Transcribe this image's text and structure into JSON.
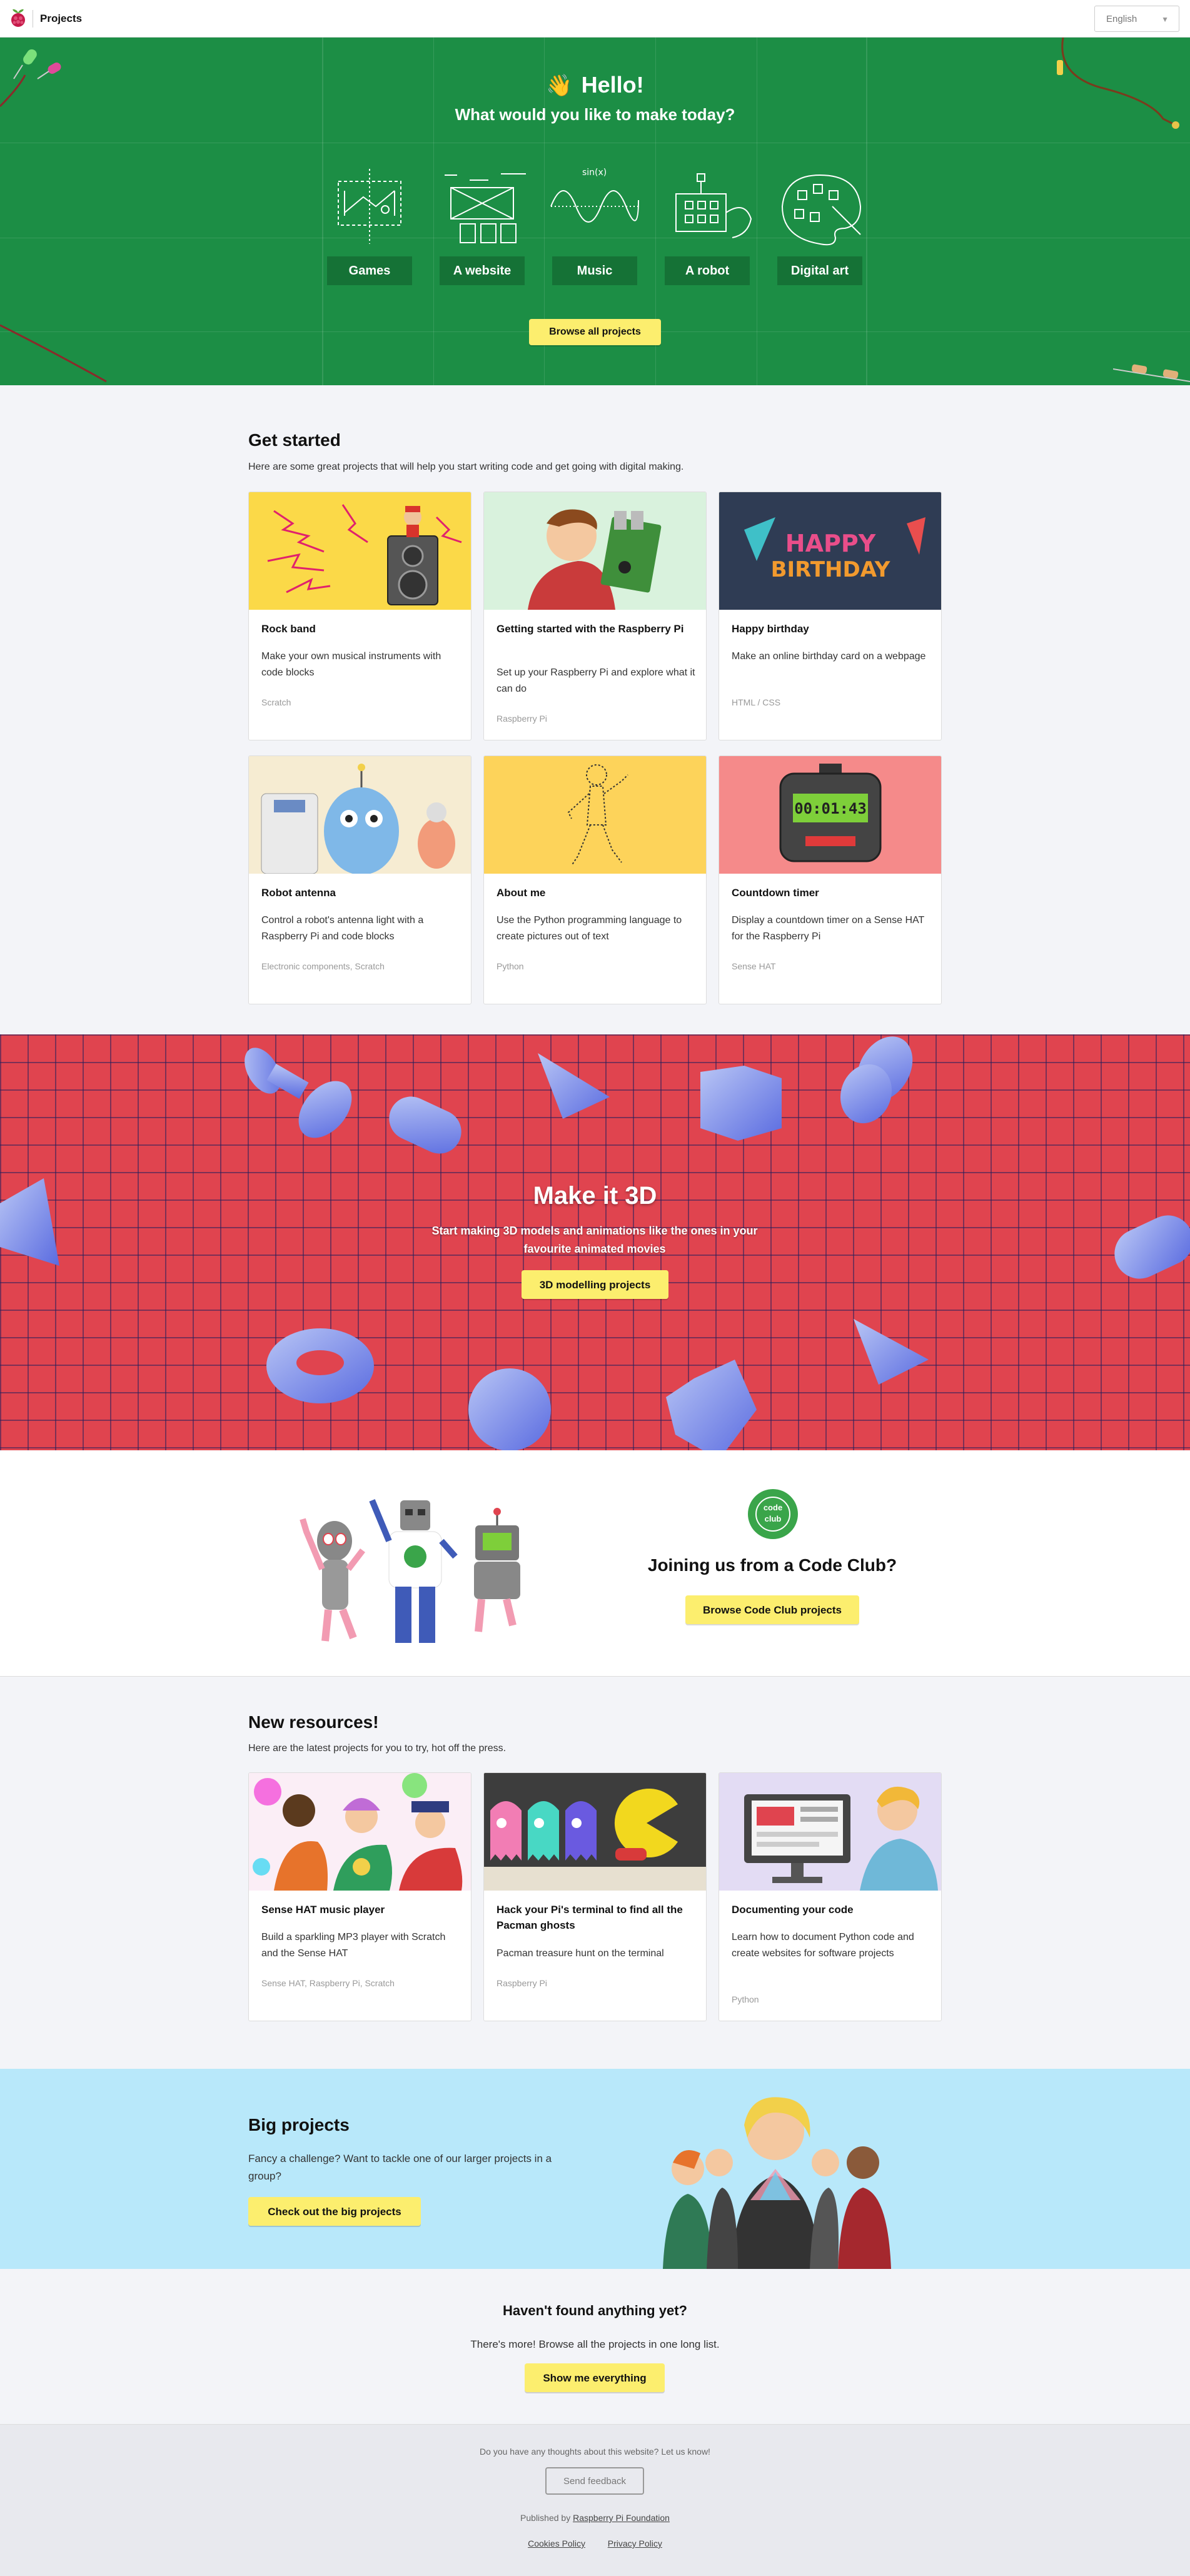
{
  "header": {
    "site_title": "Projects",
    "language": "English"
  },
  "hero": {
    "greeting": "Hello!",
    "question": "What would you like to make today?",
    "categories": [
      {
        "label": "Games",
        "icon": "games-doodle-icon"
      },
      {
        "label": "A website",
        "icon": "website-doodle-icon"
      },
      {
        "label": "Music",
        "icon": "music-doodle-icon"
      },
      {
        "label": "A robot",
        "icon": "robot-doodle-icon"
      },
      {
        "label": "Digital art",
        "icon": "palette-doodle-icon"
      }
    ],
    "browse_label": "Browse all projects"
  },
  "get_started": {
    "title": "Get started",
    "subtitle": "Here are some great projects that will help you start writing code and get going with digital making.",
    "cards": [
      {
        "title": "Rock band",
        "description": "Make your own musical instruments with code blocks",
        "tags": "Scratch"
      },
      {
        "title": "Getting started with the Raspberry Pi",
        "description": "Set up your Raspberry Pi and explore what it can do",
        "tags": "Raspberry Pi"
      },
      {
        "title": "Happy birthday",
        "description": "Make an online birthday card on a webpage",
        "tags": "HTML / CSS"
      },
      {
        "title": "Robot antenna",
        "description": "Control a robot's antenna light with a Raspberry Pi and code blocks",
        "tags": "Electronic components, Scratch"
      },
      {
        "title": "About me",
        "description": "Use the Python programming language to create pictures out of text",
        "tags": "Python"
      },
      {
        "title": "Countdown timer",
        "description": "Display a countdown timer on a Sense HAT for the Raspberry Pi",
        "tags": "Sense HAT"
      }
    ],
    "birthday_text_1": "HAPPY",
    "birthday_text_2": "BIRTHDAY",
    "timer_text": "00:01:43"
  },
  "make3d": {
    "title": "Make it 3D",
    "text": "Start making 3D models and animations like the ones in your favourite animated movies",
    "button_label": "3D modelling projects"
  },
  "code_club": {
    "logo_text_1": "code",
    "logo_text_2": "club",
    "heading": "Joining us from a Code Club?",
    "button_label": "Browse Code Club projects"
  },
  "new_resources": {
    "title": "New resources!",
    "subtitle": "Here are the latest projects for you to try, hot off the press.",
    "cards": [
      {
        "title": "Sense HAT music player",
        "description": "Build a sparkling MP3 player with Scratch and the Sense HAT",
        "tags": "Sense HAT, Raspberry Pi, Scratch"
      },
      {
        "title": "Hack your Pi's terminal to find all the Pacman ghosts",
        "description": "Pacman treasure hunt on the terminal",
        "tags": "Raspberry Pi"
      },
      {
        "title": "Documenting your code",
        "description": "Learn how to document Python code and create websites for software projects",
        "tags": "Python"
      }
    ]
  },
  "big_projects": {
    "title": "Big projects",
    "text": "Fancy a challenge? Want to tackle one of our larger projects in a group?",
    "button_label": "Check out the big projects"
  },
  "not_found": {
    "title": "Haven't found anything yet?",
    "text": "There's more! Browse all the projects in one long list.",
    "button_label": "Show me everything"
  },
  "footer": {
    "feedback_prompt": "Do you have any thoughts about this website? Let us know!",
    "feedback_button": "Send feedback",
    "published_by": "Published by",
    "foundation_link": "Raspberry Pi Foundation",
    "cookies_link": "Cookies Policy",
    "privacy_link": "Privacy Policy"
  },
  "colors": {
    "hero_green": "#1c8e45",
    "button_yellow": "#fcee6e",
    "make3d_red": "#e0444f",
    "big_projects_blue": "#b8e8fa"
  }
}
